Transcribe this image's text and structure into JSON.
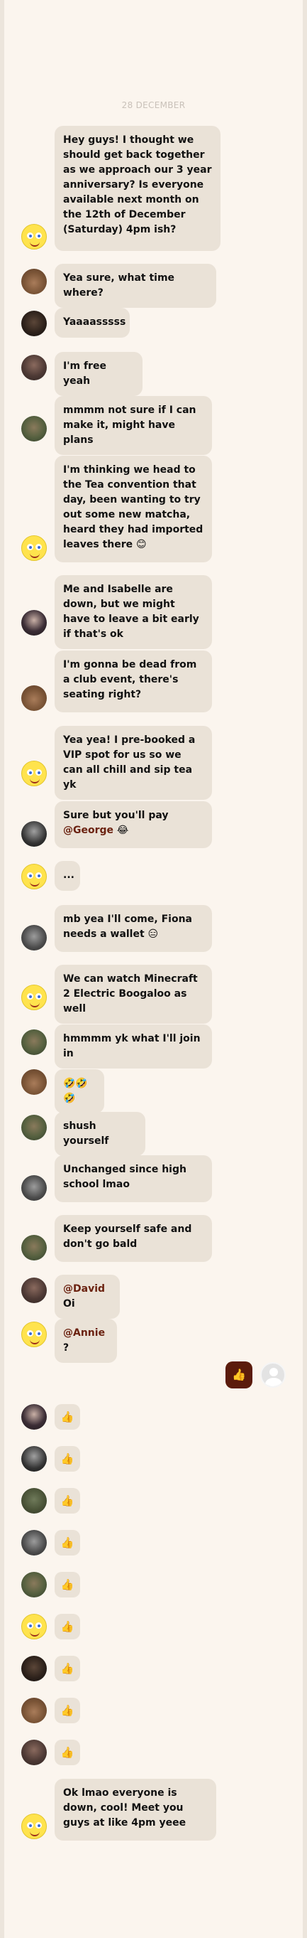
{
  "date_separator": "28 DECEMBER",
  "messages": [
    {
      "avatar": "spongebob-avatar",
      "parts": [
        {
          "t": "Hey guys! I thought we should get back together as we approach our 3 year anniversary? Is everyone available next month on the 12th of December (Saturday) 4pm ish?"
        }
      ]
    },
    {
      "avatar": "dog-avatar",
      "parts": [
        {
          "t": "Yea sure, what time where?"
        }
      ]
    },
    {
      "avatar": "dark-avatar",
      "parts": [
        {
          "t": "Yaaaasssss"
        }
      ]
    },
    {
      "avatar": "woman-avatar",
      "parts": [
        {
          "t": " I'm free yeah"
        }
      ]
    },
    {
      "avatar": "man-avatar",
      "parts": [
        {
          "t": "mmmm not sure if I can make it, might have plans"
        }
      ]
    },
    {
      "avatar": "spongebob-avatar",
      "parts": [
        {
          "t": "I'm thinking we head to the Tea convention that day, been wanting to try out some new matcha, heard they had imported leaves there 😊"
        }
      ]
    },
    {
      "avatar": "girl-avatar",
      "parts": [
        {
          "t": "Me and Isabelle are down, but we might have to leave a bit early if that's ok"
        }
      ]
    },
    {
      "avatar": "dog-avatar",
      "parts": [
        {
          "t": "I'm gonna be dead from a club event, there's seating right?"
        }
      ]
    },
    {
      "avatar": "spongebob-avatar",
      "parts": [
        {
          "t": "Yea yea! I pre-booked a VIP spot for us so we can all chill and sip tea yk"
        }
      ]
    },
    {
      "avatar": "bw-avatar",
      "parts": [
        {
          "t": "Sure but you'll pay "
        },
        {
          "t": "@George",
          "m": true
        },
        {
          "t": " 😂"
        }
      ]
    },
    {
      "avatar": "spongebob-avatar",
      "parts": [
        {
          "t": "..."
        }
      ]
    },
    {
      "avatar": "robot-avatar",
      "parts": [
        {
          "t": "mb yea I'll come, Fiona needs a wallet 😑"
        }
      ]
    },
    {
      "avatar": "spongebob-avatar",
      "parts": [
        {
          "t": "We can watch Minecraft 2 Electric Boogaloo as well"
        }
      ]
    },
    {
      "avatar": "man-avatar",
      "parts": [
        {
          "t": " hmmmm yk what I'll join in"
        }
      ]
    },
    {
      "avatar": "dog-avatar",
      "parts": [
        {
          "t": "🤣🤣🤣"
        }
      ]
    },
    {
      "avatar": "man-avatar",
      "parts": [
        {
          "t": "shush yourself"
        }
      ]
    },
    {
      "avatar": "robot-avatar",
      "parts": [
        {
          "t": "Unchanged since high school lmao"
        }
      ]
    },
    {
      "avatar": "man-avatar",
      "parts": [
        {
          "t": "Keep yourself safe and don't go bald"
        }
      ]
    },
    {
      "avatar": "woman-avatar",
      "parts": [
        {
          "t": "@David",
          "m": true
        },
        {
          "t": " Oi"
        }
      ]
    },
    {
      "avatar": "spongebob-avatar",
      "parts": [
        {
          "t": "@Annie",
          "m": true
        },
        {
          "t": " ?"
        }
      ]
    }
  ],
  "my_reaction": "👍",
  "reactions": [
    {
      "avatar": "girl-avatar",
      "emoji": "👍"
    },
    {
      "avatar": "bw-avatar",
      "emoji": "👍"
    },
    {
      "avatar": "outdoor-avatar",
      "emoji": "👍"
    },
    {
      "avatar": "robot-avatar",
      "emoji": "👍"
    },
    {
      "avatar": "man-avatar",
      "emoji": "👍"
    },
    {
      "avatar": "spongebob-avatar",
      "emoji": "👍"
    },
    {
      "avatar": "dark-avatar",
      "emoji": "👍"
    },
    {
      "avatar": "dog-avatar",
      "emoji": "👍"
    },
    {
      "avatar": "woman-avatar",
      "emoji": "👍"
    }
  ],
  "final_message": {
    "avatar": "spongebob-avatar",
    "parts": [
      {
        "t": "Ok lmao everyone is down, cool! Meet you guys at like 4pm yeee"
      }
    ]
  }
}
